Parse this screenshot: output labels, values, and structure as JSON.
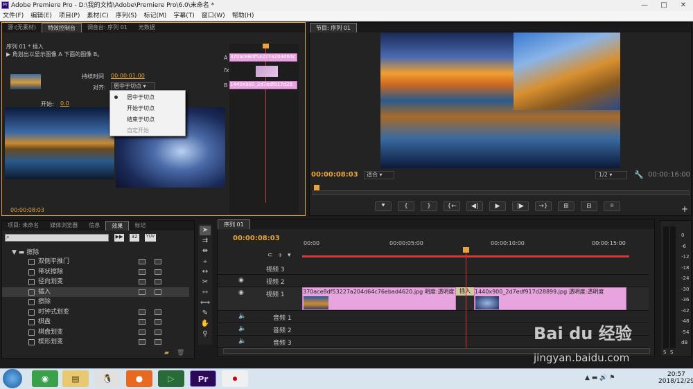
{
  "app": {
    "title": "Adobe Premiere Pro - D:\\我的文档\\Adobe\\Premiere Pro\\6.0\\未命名 *",
    "logo": "Pr"
  },
  "menu": [
    "文件(F)",
    "编辑(E)",
    "项目(P)",
    "素材(C)",
    "序列(S)",
    "标记(M)",
    "字幕(T)",
    "窗口(W)",
    "帮助(H)"
  ],
  "source_panel": {
    "tabs": [
      "源:(无素材)",
      "特效控制台",
      "调音台: 序列 01",
      "元数据"
    ],
    "sequence": "序列 01 * 插入",
    "description": "角划出以显示图像 A 下面的图像 B。",
    "duration_label": "持续时间",
    "duration_value": "00:00:01:00",
    "align_label": "对齐:",
    "align_value": "居中于切点",
    "start_label": "开始:",
    "start_value": "0.0",
    "align_options": [
      "居中于切点",
      "开始于切点",
      "结束于切点",
      "自定开始"
    ],
    "clip_a": "370ace8df53227a204d64c",
    "clip_b": "1440x900_2d7edf917d28",
    "track_a": "A",
    "track_b": "B",
    "fx": "fx",
    "timecode": "00:00:08:03"
  },
  "program_panel": {
    "tab": "节目: 序列 01",
    "timecode": "00:00:08:03",
    "fit": "适合",
    "ratio": "1/2",
    "duration": "00:00:16:00",
    "buttons": [
      "⯆",
      "{",
      "}",
      "{←",
      "◀|",
      "▶",
      "|▶",
      "→}",
      "⊞",
      "⊟",
      "⌾"
    ]
  },
  "project_panel": {
    "tabs": [
      "项目: 未命名",
      "媒体浏览器",
      "信息",
      "效果",
      "标记"
    ],
    "badges": [
      "32",
      "YUV"
    ],
    "folder": "擦除",
    "effects": [
      "双侧平推门",
      "带状擦除",
      "径向划变",
      "插入",
      "擦除",
      "时钟式划变",
      "棋盘",
      "棋盘划变",
      "楔形划变"
    ]
  },
  "timeline": {
    "tab": "序列 01",
    "timecode": "00:00:08:03",
    "ruler": [
      "00:00",
      "00:00:05:00",
      "00:00:10:00",
      "00:00:15:00"
    ],
    "tracks": [
      "视频 3",
      "视频 2",
      "视频 1",
      "音频 1",
      "音频 2",
      "音频 3"
    ],
    "clip1": "370ace8df53227a204d64c76ebad4620.jpg",
    "clip1_fx": "明度:透明度",
    "transition": "插入",
    "clip2": "1440x900_2d7edf917d28899.jpg",
    "clip2_fx": "透明度:透明度"
  },
  "meter": {
    "labels": [
      "0",
      "-6",
      "-12",
      "-18",
      "-24",
      "-30",
      "-36",
      "-42",
      "-48",
      "-54",
      "dB"
    ],
    "solo": [
      "S",
      "S"
    ]
  },
  "taskbar": {
    "time": "20:57",
    "date": "2018/12/29",
    "apps": [
      "chrome-icon",
      "explorer-icon",
      "qq-icon",
      "firefox-icon",
      "camtasia-icon",
      "premiere-icon",
      "record-icon"
    ],
    "pr_label": "Pr"
  },
  "watermark": {
    "brand": "Bai du 经验",
    "url": "jingyan.baidu.com"
  },
  "colors": {
    "accent": "#e8a43a",
    "clip": "#e7a4de",
    "playhead": "#d43a3a"
  }
}
